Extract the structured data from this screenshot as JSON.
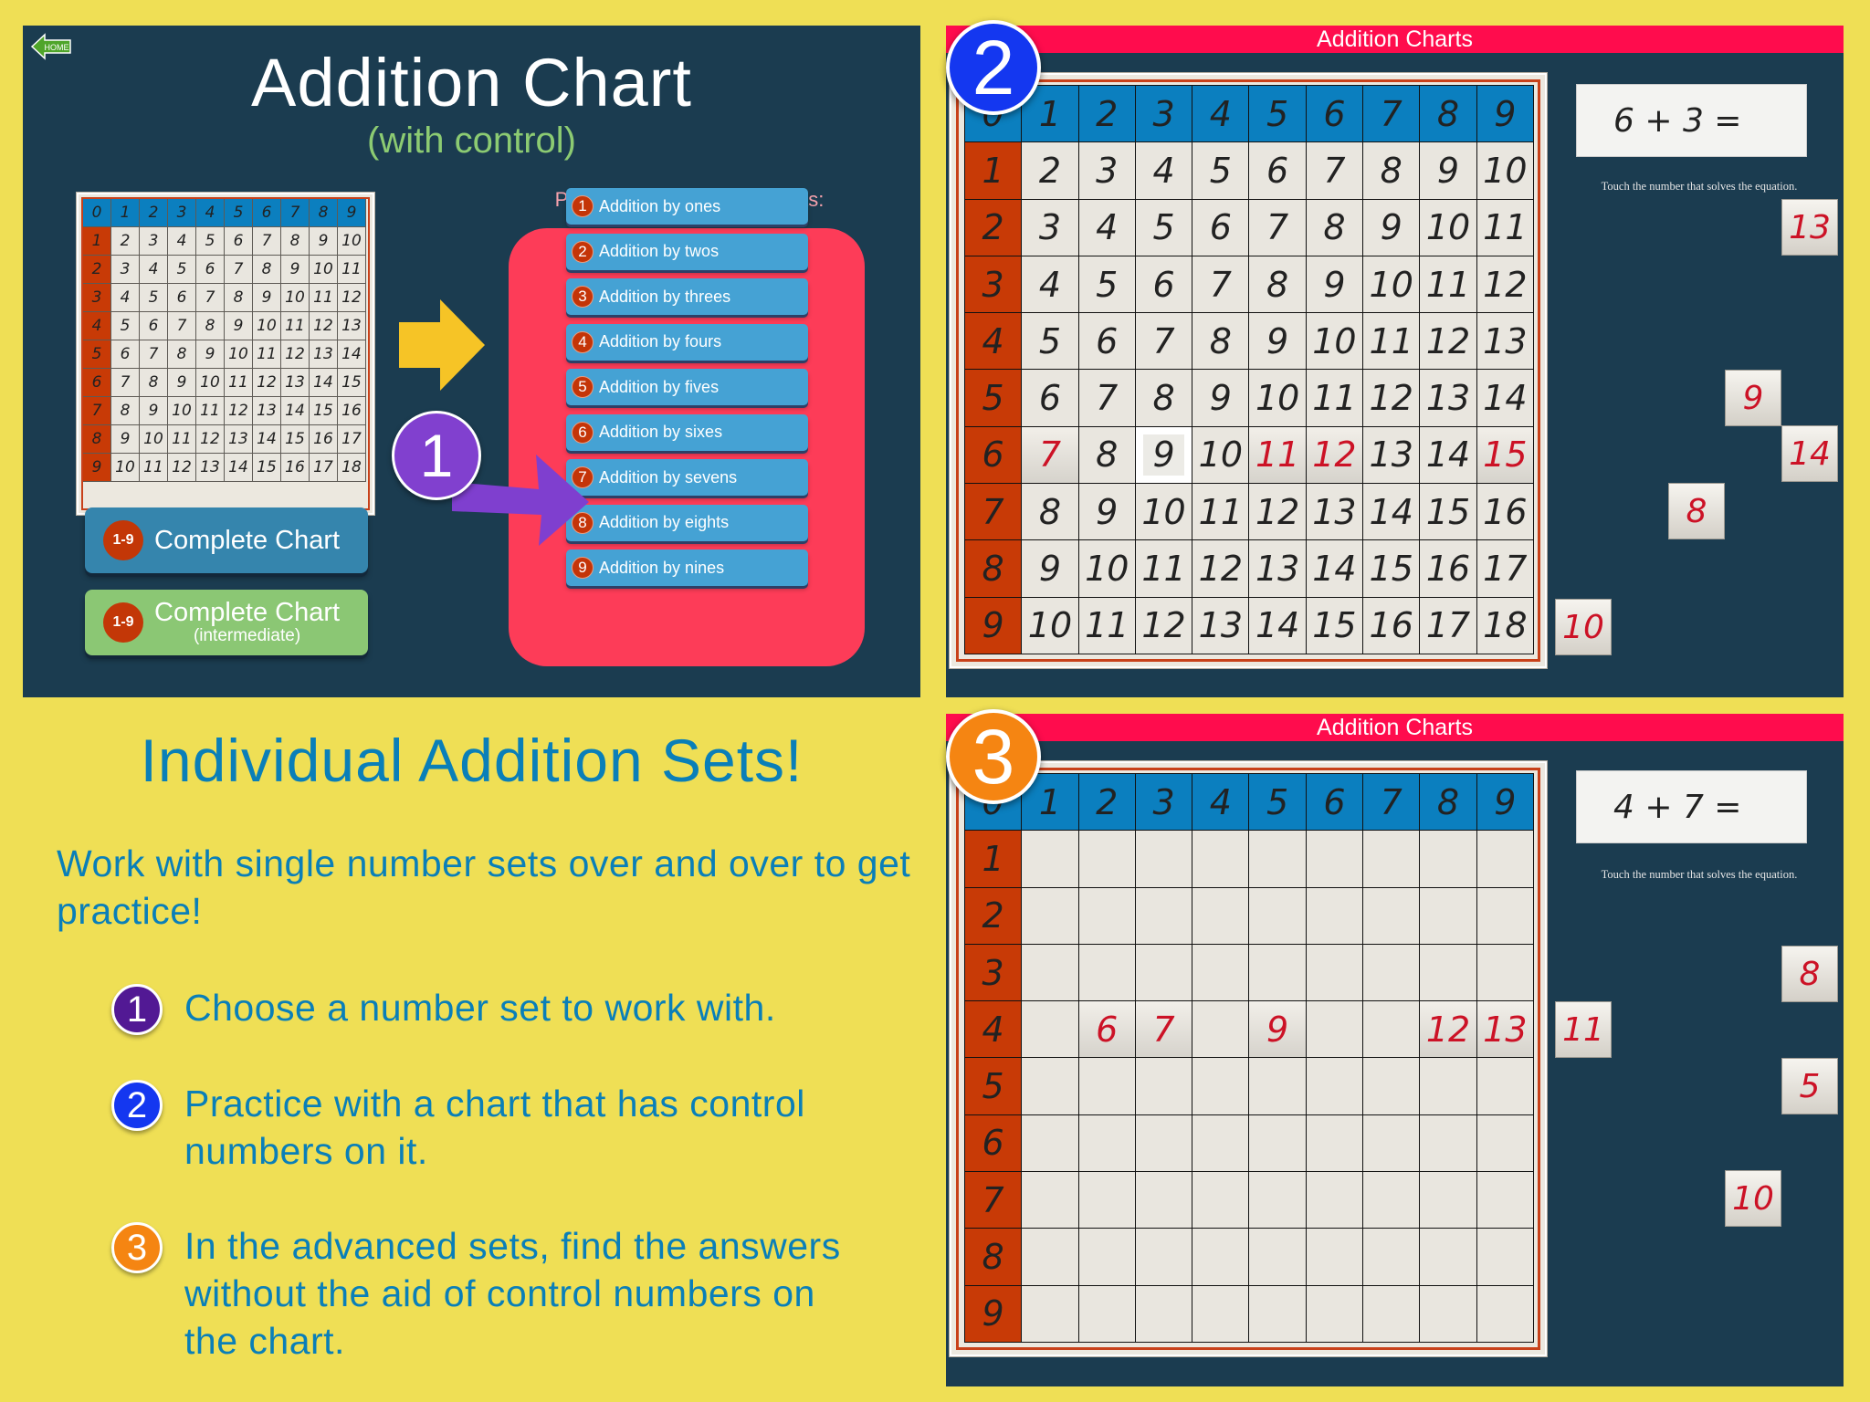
{
  "colors": {
    "background": "#efdf55",
    "panel": "#1b3c50",
    "header_blue": "#0b7fbf",
    "row_header_red": "#c83a06",
    "cell": "#e9e6df",
    "placed_number": "#cc1226",
    "topbar": "#ff0c4d",
    "sets_box": "#fd3c58",
    "set_button": "#45a2d4",
    "step1": "#8140cf",
    "step2": "#1437f0",
    "step3": "#f58512",
    "text_blue": "#0a7fb8"
  },
  "panel1": {
    "home_label": "HOME",
    "title": "Addition Chart",
    "subtitle": "(with control)",
    "chart_headers": [
      "0",
      "1",
      "2",
      "3",
      "4",
      "5",
      "6",
      "7",
      "8",
      "9"
    ],
    "chart_rows": [
      1,
      2,
      3,
      4,
      5,
      6,
      7,
      8,
      9
    ],
    "sets_label": "Practice specific addition sets:",
    "sets": [
      {
        "num": "1",
        "label": "Addition by ones"
      },
      {
        "num": "2",
        "label": "Addition by twos"
      },
      {
        "num": "3",
        "label": "Addition by threes"
      },
      {
        "num": "4",
        "label": "Addition by fours"
      },
      {
        "num": "5",
        "label": "Addition by fives"
      },
      {
        "num": "6",
        "label": "Addition by sixes"
      },
      {
        "num": "7",
        "label": "Addition by sevens"
      },
      {
        "num": "8",
        "label": "Addition by eights"
      },
      {
        "num": "9",
        "label": "Addition by nines"
      }
    ],
    "complete_chart": {
      "badge": "1-9",
      "label": "Complete Chart"
    },
    "complete_chart_intermediate": {
      "badge": "1-9",
      "label": "Complete Chart",
      "sublabel": "(intermediate)"
    },
    "step_badge": "1"
  },
  "panel2": {
    "topbar_title": "Addition Charts",
    "step_badge": "2",
    "equation": "6 + 3 =",
    "instruction": "Touch the number that solves the equation.",
    "show_control_numbers": true,
    "active_row": 6,
    "placed_in_row": [
      7,
      11,
      12,
      15
    ],
    "target_value": 9,
    "answer_tiles": [
      "13",
      "9",
      "14",
      "8",
      "10"
    ]
  },
  "panel3": {
    "topbar_title": "Addition Charts",
    "step_badge": "3",
    "equation": "4 + 7 =",
    "instruction": "Touch the number that solves the equation.",
    "show_control_numbers": false,
    "active_row": 4,
    "placed_in_row": [
      6,
      7,
      9,
      12,
      13
    ],
    "answer_tiles": [
      "11",
      "8",
      "5",
      "10"
    ]
  },
  "text": {
    "heading": "Individual Addition Sets!",
    "intro": "Work with single number sets over and over to get practice!",
    "steps": [
      {
        "num": "1",
        "text": "Choose a number set to work with."
      },
      {
        "num": "2",
        "text": "Practice with a chart that has control numbers on it."
      },
      {
        "num": "3",
        "text": "In the advanced sets, find the answers without the aid of control numbers on the chart."
      }
    ]
  }
}
